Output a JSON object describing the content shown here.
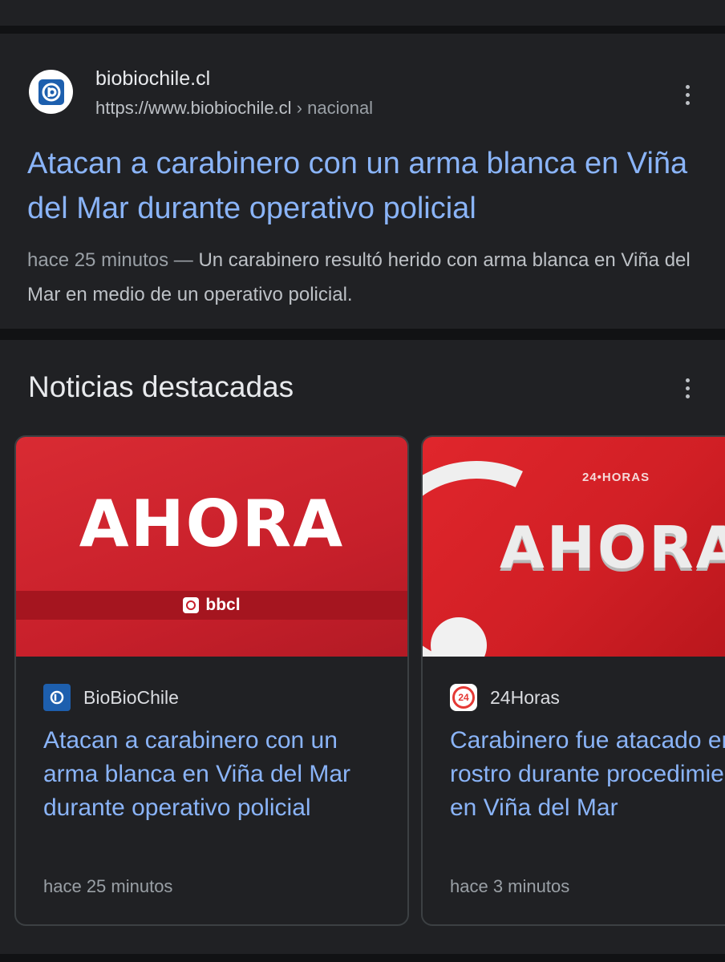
{
  "result": {
    "site_name": "biobiochile.cl",
    "url": "https://www.biobiochile.cl",
    "breadcrumb": " › nacional",
    "title": "Atacan a carabinero con un arma blanca en Viña del Mar durante operativo policial",
    "age": "hace 25 minutos",
    "separator": " — ",
    "snippet": "Un carabinero resultó herido con arma blanca en Viña del Mar en medio de un operativo policial."
  },
  "news": {
    "section_title": "Noticias destacadas",
    "cards": [
      {
        "thumb_text": "AHORA",
        "thumb_brand": "bbcl",
        "source": "BioBioChile",
        "title": "Atacan a carabinero con un arma blanca en Viña del Mar durante operativo policial",
        "age": "hace 25 minutos"
      },
      {
        "thumb_text": "AHORA",
        "thumb_brand": "24•HORAS",
        "source": "24Horas",
        "icon_text": "24",
        "title": "Carabinero fue atacado en el rostro durante procedimiento en Viña del Mar",
        "age": "hace 3 minutos"
      }
    ]
  },
  "icons": {
    "site_logo": "biobiochile-logo-icon",
    "menu": "more-vert-icon"
  },
  "colors": {
    "link": "#8ab4f8",
    "background": "#202124",
    "bbcl_red": "#d92b33"
  }
}
